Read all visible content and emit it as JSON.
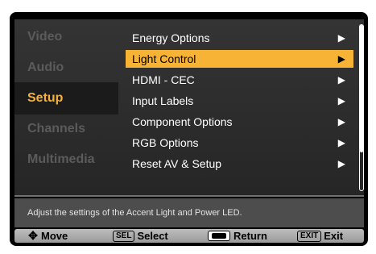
{
  "sidebar": {
    "items": [
      {
        "label": "Video"
      },
      {
        "label": "Audio"
      },
      {
        "label": "Setup"
      },
      {
        "label": "Channels"
      },
      {
        "label": "Multimedia"
      }
    ],
    "active_index": 2
  },
  "menu": {
    "items": [
      {
        "label": "Energy Options"
      },
      {
        "label": "Light Control"
      },
      {
        "label": "HDMI - CEC"
      },
      {
        "label": "Input Labels"
      },
      {
        "label": "Component Options"
      },
      {
        "label": "RGB Options"
      },
      {
        "label": "Reset AV & Setup"
      }
    ],
    "selected_index": 1,
    "arrow_glyph": "▶"
  },
  "description": "Adjust the settings of the Accent Light and Power LED.",
  "footer": {
    "move_label": "Move",
    "sel_key": "SEL",
    "select_label": "Select",
    "return_label": "Return",
    "exit_key": "EXIT",
    "exit_label": "Exit"
  },
  "colors": {
    "accent": "#f6b335",
    "active_sidebar_text": "#f4b13e",
    "inactive_sidebar_text": "#5b5b5b"
  }
}
